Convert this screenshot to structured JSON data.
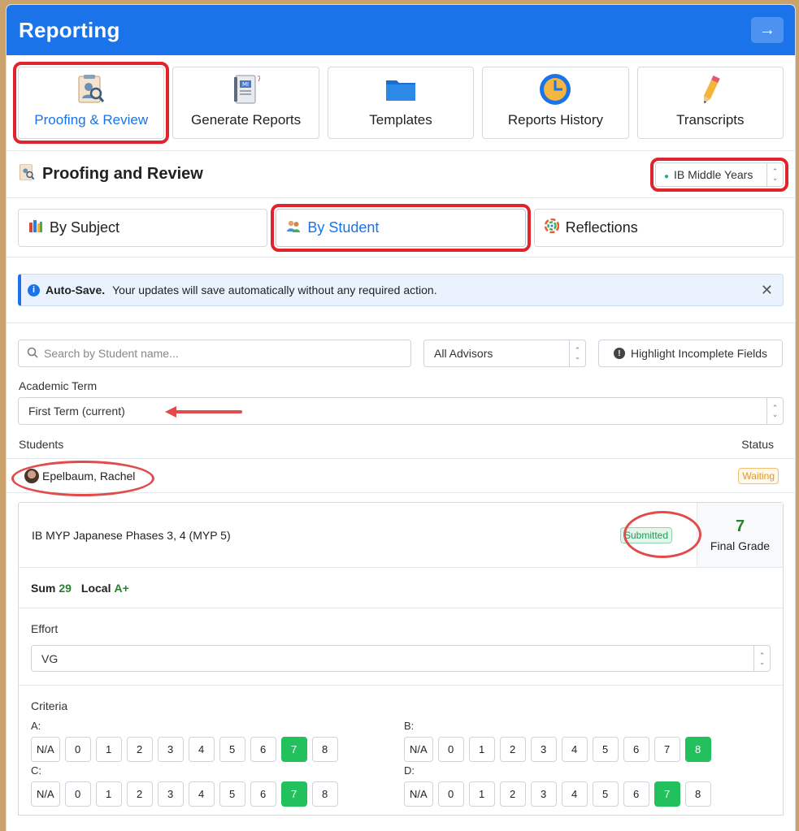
{
  "header": {
    "title": "Reporting"
  },
  "tiles": [
    {
      "label": "Proofing & Review",
      "icon": "proofing-icon"
    },
    {
      "label": "Generate Reports",
      "icon": "report-cards-icon"
    },
    {
      "label": "Templates",
      "icon": "folder-icon"
    },
    {
      "label": "Reports History",
      "icon": "clock-icon"
    },
    {
      "label": "Transcripts",
      "icon": "pencil-icon"
    }
  ],
  "section": {
    "title": "Proofing and Review",
    "program": "IB Middle Years"
  },
  "subtabs": [
    {
      "label": "By Subject",
      "icon": "books-icon"
    },
    {
      "label": "By Student",
      "icon": "students-icon"
    },
    {
      "label": "Reflections",
      "icon": "reflections-icon"
    }
  ],
  "alert": {
    "title": "Auto-Save.",
    "message": "Your updates will save automatically without any required action."
  },
  "filters": {
    "search_placeholder": "Search by Student name...",
    "advisor": "All Advisors",
    "highlight_button": "Highlight Incomplete Fields"
  },
  "term": {
    "label": "Academic Term",
    "value": "First Term (current)"
  },
  "students_table": {
    "col_students": "Students",
    "col_status": "Status"
  },
  "student": {
    "name": "Epelbaum, Rachel",
    "status": "Waiting"
  },
  "course": {
    "name": "IB MYP Japanese Phases 3, 4 (MYP 5)",
    "status": "Submitted",
    "final_grade": "7",
    "final_grade_label": "Final Grade",
    "sum_label": "Sum",
    "sum_value": "29",
    "local_label": "Local",
    "local_value": "A+"
  },
  "effort": {
    "label": "Effort",
    "value": "VG"
  },
  "criteria": {
    "label": "Criteria",
    "options": [
      "N/A",
      "0",
      "1",
      "2",
      "3",
      "4",
      "5",
      "6",
      "7",
      "8"
    ],
    "items": [
      {
        "label": "A:",
        "selected": "7"
      },
      {
        "label": "B:",
        "selected": "8"
      },
      {
        "label": "C:",
        "selected": "7"
      },
      {
        "label": "D:",
        "selected": "7"
      }
    ]
  },
  "colors": {
    "primary": "#1a73e8",
    "selected_score": "#22c15e",
    "annotation": "#e0242b"
  }
}
